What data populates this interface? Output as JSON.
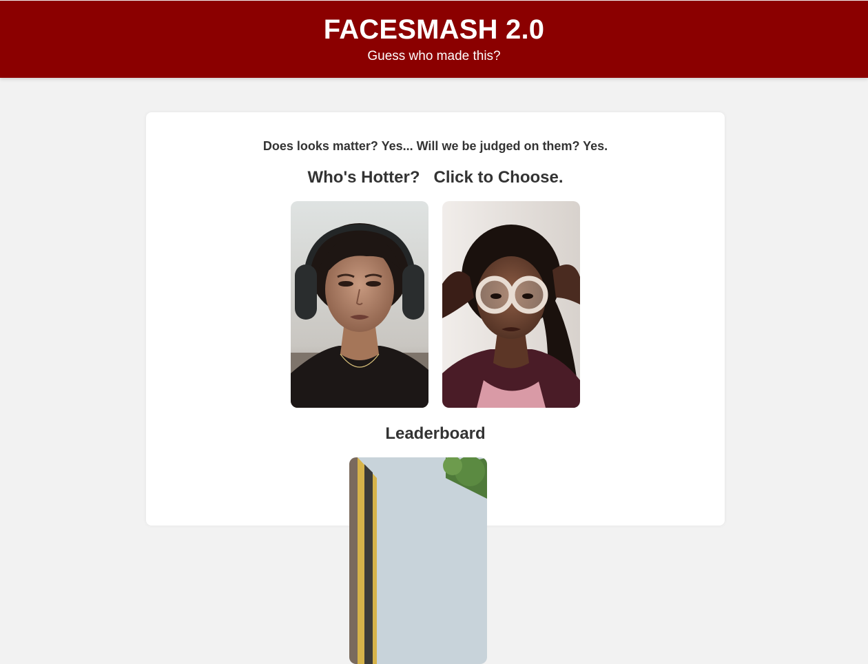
{
  "header": {
    "title": "FACESMASH 2.0",
    "subtitle": "Guess who made this?"
  },
  "main": {
    "tagline": "Does looks matter? Yes... Will we be judged on them? Yes.",
    "prompt_question": "Who's Hotter?",
    "prompt_action": "Click to Choose.",
    "leaderboard_title": "Leaderboard"
  },
  "colors": {
    "header_bg": "#8b0000",
    "page_bg": "#f2f2f2",
    "card_bg": "#ffffff",
    "text": "#333333"
  }
}
